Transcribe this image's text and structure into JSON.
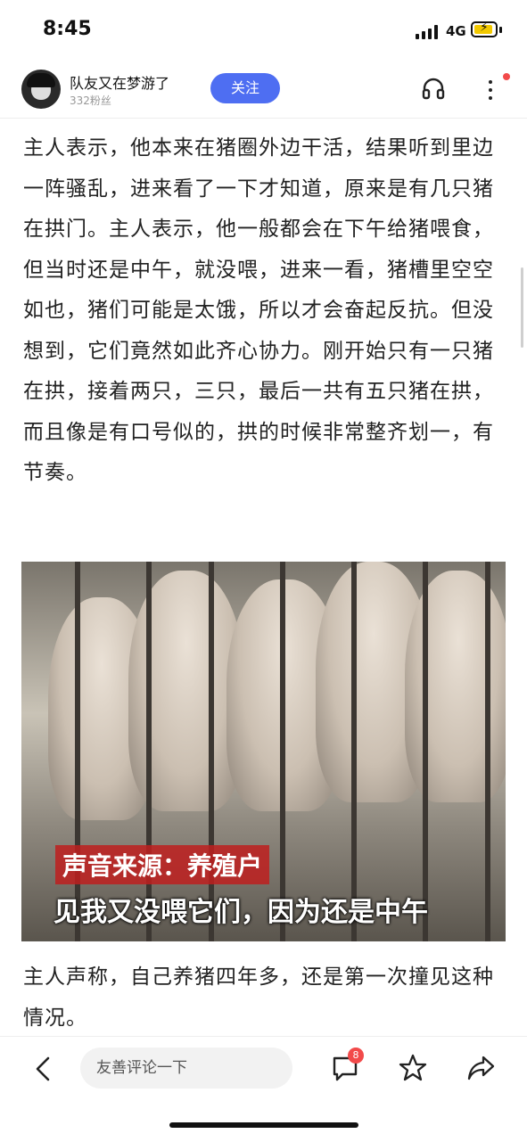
{
  "status_bar": {
    "time": "8:45",
    "network": "4G",
    "battery_level": 0.7,
    "battery_color": "#f2c900"
  },
  "header": {
    "author_name": "队友又在梦游了",
    "followers": "332粉丝",
    "follow_label": "关注",
    "follow_color": "#4e6ef2",
    "icons": [
      "headphones-icon",
      "more-icon"
    ],
    "notification_dot_color": "#f24a4a"
  },
  "article": {
    "paragraph1": "主人表示，他本来在猪圈外边干活，结果听到里边一阵骚乱，进来看了一下才知道，原来是有几只猪在拱门。主人表示，他一般都会在下午给猪喂食，但当时还是中午，就没喂，进来一看，猪槽里空空如也，猪们可能是太饿，所以才会奋起反抗。但没想到，它们竟然如此齐心协力。刚开始只有一只猪在拱，接着两只，三只，最后一共有五只猪在拱，而且像是有口号似的，拱的时候非常整齐划一，有节奏。",
    "image": {
      "caption_source": "声音来源：养殖户",
      "caption_subtitle": "见我又没喂它们，因为还是中午"
    },
    "paragraph2": "主人声称，自己养猪四年多，还是第一次撞见这种情况。"
  },
  "bottom_bar": {
    "comment_placeholder": "友善评论一下",
    "comment_badge": "8",
    "icons": [
      "back-icon",
      "comment-icon",
      "star-icon",
      "share-icon"
    ]
  }
}
